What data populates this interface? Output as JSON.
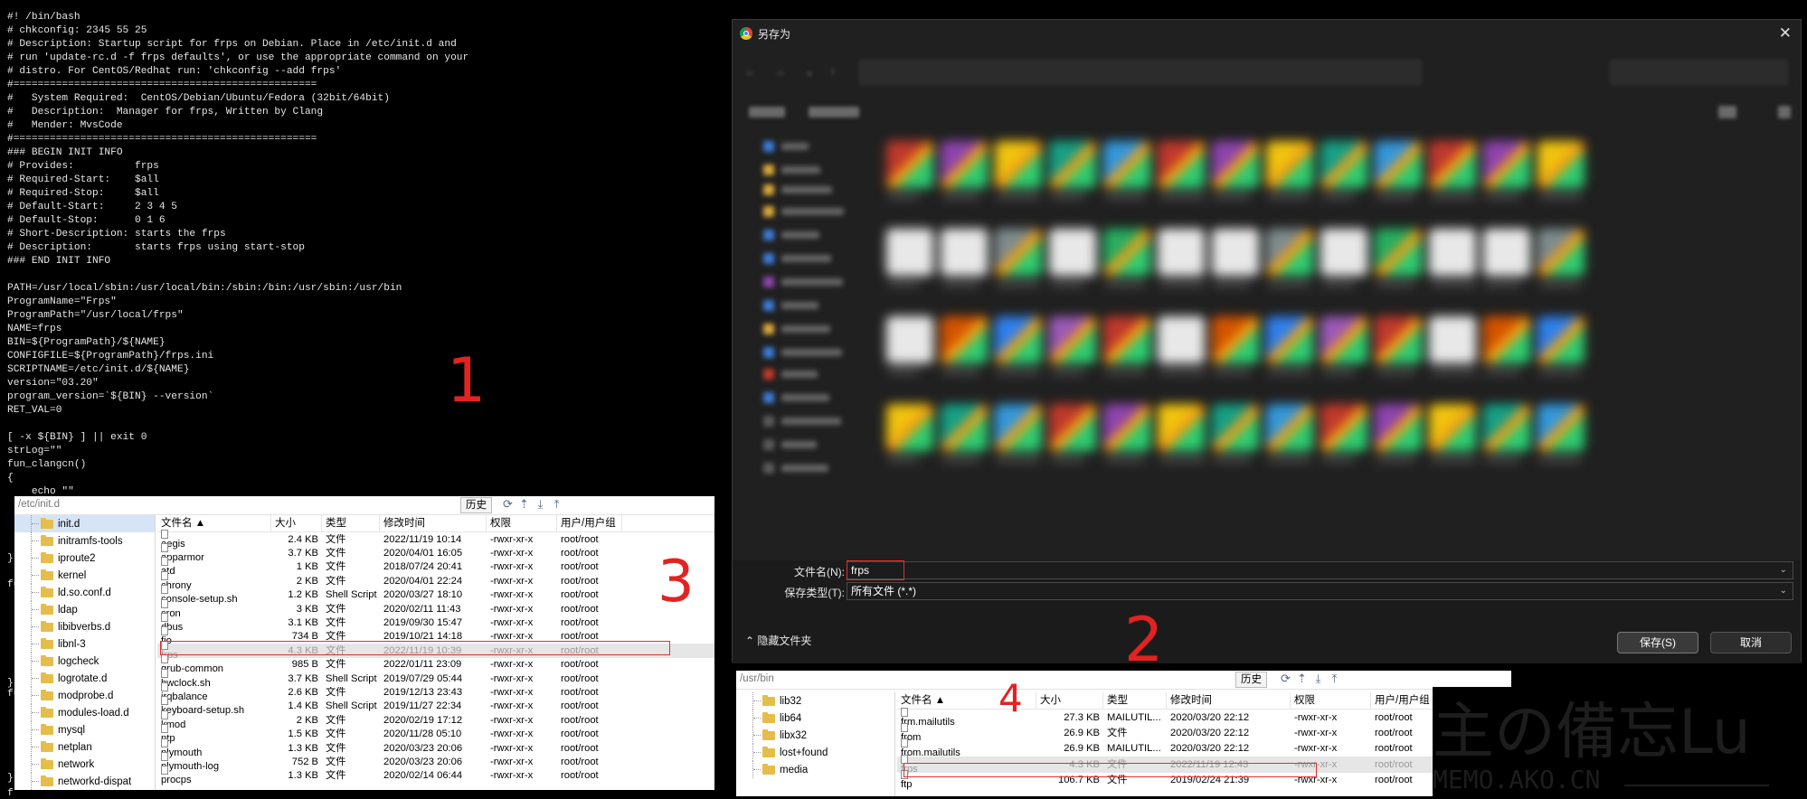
{
  "terminal": {
    "lines": [
      "#! /bin/bash",
      "# chkconfig: 2345 55 25",
      "# Description: Startup script for frps on Debian. Place in /etc/init.d and",
      "# run 'update-rc.d -f frps defaults', or use the appropriate command on your",
      "# distro. For CentOS/Redhat run: 'chkconfig --add frps'",
      "#==================================================",
      "#   System Required:  CentOS/Debian/Ubuntu/Fedora (32bit/64bit)",
      "#   Description:  Manager for frps, Written by Clang",
      "#   Mender: MvsCode",
      "#==================================================",
      "### BEGIN INIT INFO",
      "# Provides:          frps",
      "# Required-Start:    $all",
      "# Required-Stop:     $all",
      "# Default-Start:     2 3 4 5",
      "# Default-Stop:      0 1 6",
      "# Short-Description: starts the frps",
      "# Description:       starts frps using start-stop",
      "### END INIT INFO",
      "",
      "PATH=/usr/local/sbin:/usr/local/bin:/sbin:/bin:/usr/sbin:/usr/bin",
      "ProgramName=\"Frps\"",
      "ProgramPath=\"/usr/local/frps\"",
      "NAME=frps",
      "BIN=${ProgramPath}/${NAME}",
      "CONFIGFILE=${ProgramPath}/frps.ini",
      "SCRIPTNAME=/etc/init.d/${NAME}",
      "version=\"03.20\"",
      "program_version=`${BIN} --version`",
      "RET_VAL=0",
      "",
      "[ -x ${BIN} ] || exit 0",
      "strLog=\"\"",
      "fun_clangcn()",
      "{",
      "    echo \"\""
    ],
    "edge_fragments": [
      "}",
      "fu",
      "}",
      "fu",
      "}",
      "f"
    ]
  },
  "markers": [
    "1",
    "2",
    "3",
    "4"
  ],
  "panel_etc": {
    "path": "/etc/init.d",
    "history_label": "历史",
    "toolbar_icons": [
      "refresh-icon",
      "up-icon",
      "download-icon",
      "upload-icon"
    ],
    "tree": [
      "init.d",
      "initramfs-tools",
      "iproute2",
      "kernel",
      "ld.so.conf.d",
      "ldap",
      "libibverbs.d",
      "libnl-3",
      "logcheck",
      "logrotate.d",
      "modprobe.d",
      "modules-load.d",
      "mysql",
      "netplan",
      "network",
      "networkd-dispat"
    ],
    "columns": [
      "文件名 ▲",
      "大小",
      "类型",
      "修改时间",
      "权限",
      "用户/用户组"
    ],
    "rows": [
      [
        "aegis",
        "2.4 KB",
        "文件",
        "2022/11/19 10:14",
        "-rwxr-xr-x",
        "root/root"
      ],
      [
        "apparmor",
        "3.7 KB",
        "文件",
        "2020/04/01 16:05",
        "-rwxr-xr-x",
        "root/root"
      ],
      [
        "atd",
        "1 KB",
        "文件",
        "2018/07/24 20:41",
        "-rwxr-xr-x",
        "root/root"
      ],
      [
        "chrony",
        "2 KB",
        "文件",
        "2020/04/01 22:24",
        "-rwxr-xr-x",
        "root/root"
      ],
      [
        "console-setup.sh",
        "1.2 KB",
        "Shell Script",
        "2020/03/27 18:10",
        "-rwxr-xr-x",
        "root/root"
      ],
      [
        "cron",
        "3 KB",
        "文件",
        "2020/02/11 11:43",
        "-rwxr-xr-x",
        "root/root"
      ],
      [
        "dbus",
        "3.1 KB",
        "文件",
        "2019/09/30 15:47",
        "-rwxr-xr-x",
        "root/root"
      ],
      [
        "fio",
        "734 B",
        "文件",
        "2019/10/21 14:18",
        "-rwxr-xr-x",
        "root/root"
      ],
      [
        "frps",
        "4.3 KB",
        "文件",
        "2022/11/19 10:39",
        "-rwxr-xr-x",
        "root/root"
      ],
      [
        "grub-common",
        "985 B",
        "文件",
        "2022/01/11 23:09",
        "-rwxr-xr-x",
        "root/root"
      ],
      [
        "hwclock.sh",
        "3.7 KB",
        "Shell Script",
        "2019/07/29 05:44",
        "-rwxr-xr-x",
        "root/root"
      ],
      [
        "irqbalance",
        "2.6 KB",
        "文件",
        "2019/12/13 23:43",
        "-rwxr-xr-x",
        "root/root"
      ],
      [
        "keyboard-setup.sh",
        "1.4 KB",
        "Shell Script",
        "2019/11/27 22:34",
        "-rwxr-xr-x",
        "root/root"
      ],
      [
        "kmod",
        "2 KB",
        "文件",
        "2020/02/19 17:12",
        "-rwxr-xr-x",
        "root/root"
      ],
      [
        "ntp",
        "1.5 KB",
        "文件",
        "2020/11/28 05:10",
        "-rwxr-xr-x",
        "root/root"
      ],
      [
        "plymouth",
        "1.3 KB",
        "文件",
        "2020/03/23 20:06",
        "-rwxr-xr-x",
        "root/root"
      ],
      [
        "plymouth-log",
        "752 B",
        "文件",
        "2020/03/23 20:06",
        "-rwxr-xr-x",
        "root/root"
      ],
      [
        "procps",
        "1.3 KB",
        "文件",
        "2020/02/14 06:44",
        "-rwxr-xr-x",
        "root/root"
      ]
    ]
  },
  "panel_usr": {
    "path": "/usr/bin",
    "history_label": "历史",
    "toolbar_icons": [
      "refresh-icon",
      "up-icon",
      "download-icon",
      "upload-icon"
    ],
    "tree": [
      "lib32",
      "lib64",
      "libx32",
      "lost+found",
      "media"
    ],
    "columns": [
      "文件名 ▲",
      "大小",
      "类型",
      "修改时间",
      "权限",
      "用户/用户组"
    ],
    "rows": [
      [
        "frm.mailutils",
        "27.3 KB",
        "MAILUTIL...",
        "2020/03/20 22:12",
        "-rwxr-xr-x",
        "root/root"
      ],
      [
        "from",
        "26.9 KB",
        "文件",
        "2020/03/20 22:12",
        "-rwxr-xr-x",
        "root/root"
      ],
      [
        "from.mailutils",
        "26.9 KB",
        "MAILUTIL...",
        "2020/03/20 22:12",
        "-rwxr-xr-x",
        "root/root"
      ],
      [
        "frps",
        "4.3 KB",
        "文件",
        "2022/11/19 12:43",
        "-rwxr-xr-x",
        "root/root"
      ],
      [
        "ftp",
        "106.7 KB",
        "文件",
        "2019/02/24 21:39",
        "-rwxr-xr-x",
        "root/root"
      ]
    ]
  },
  "save_dialog": {
    "title": "另存为",
    "filename_label": "文件名(N):",
    "filename_value": "frps",
    "filetype_label": "保存类型(T):",
    "filetype_value": "所有文件 (*.*)",
    "hide_folders": "隐藏文件夹",
    "save_button": "保存(S)",
    "cancel_button": "取消"
  },
  "watermark": {
    "big": "主の備忘Lu",
    "small": "MEMO.AKO.CN"
  },
  "colors": {
    "marker_red": "#e32222",
    "dialog_bg": "#202020",
    "highlight_row": "#e6e6e6"
  }
}
